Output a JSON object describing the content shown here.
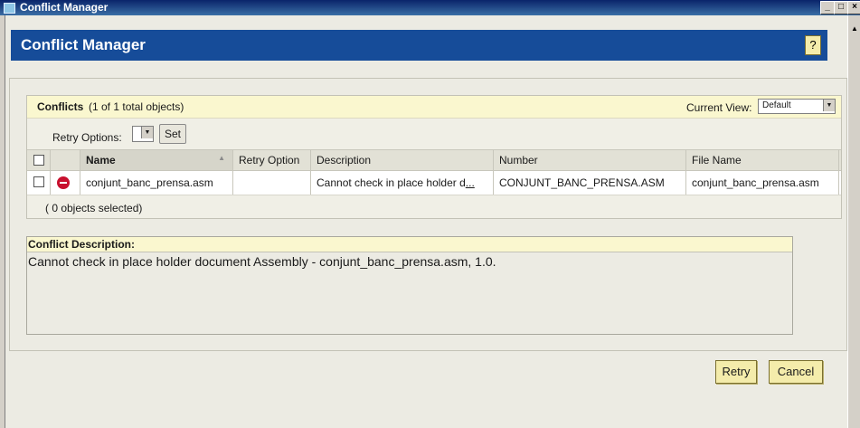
{
  "window": {
    "title": "Conflict Manager"
  },
  "header": {
    "title": "Conflict Manager",
    "help_label": "?"
  },
  "conflicts": {
    "label": "Conflicts",
    "count_text": "(1 of 1 total objects)",
    "current_view_label": "Current View:",
    "current_view_value": "Default",
    "retry_options_label": "Retry Options:",
    "set_label": "Set",
    "columns": [
      "Name",
      "Retry Option",
      "Description",
      "Number",
      "File Name"
    ],
    "rows": [
      {
        "name": "conjunt_banc_prensa.asm",
        "retry_option": "",
        "description": "Cannot check in place holder d",
        "description_more": "...",
        "number": "CONJUNT_BANC_PRENSA.ASM",
        "file_name": "conjunt_banc_prensa.asm"
      }
    ],
    "selected_text": "( 0 objects selected)"
  },
  "description": {
    "label": "Conflict Description:",
    "text": "Cannot check in place holder document Assembly  - conjunt_banc_prensa.asm, 1.0."
  },
  "buttons": {
    "retry": "Retry",
    "cancel": "Cancel"
  }
}
